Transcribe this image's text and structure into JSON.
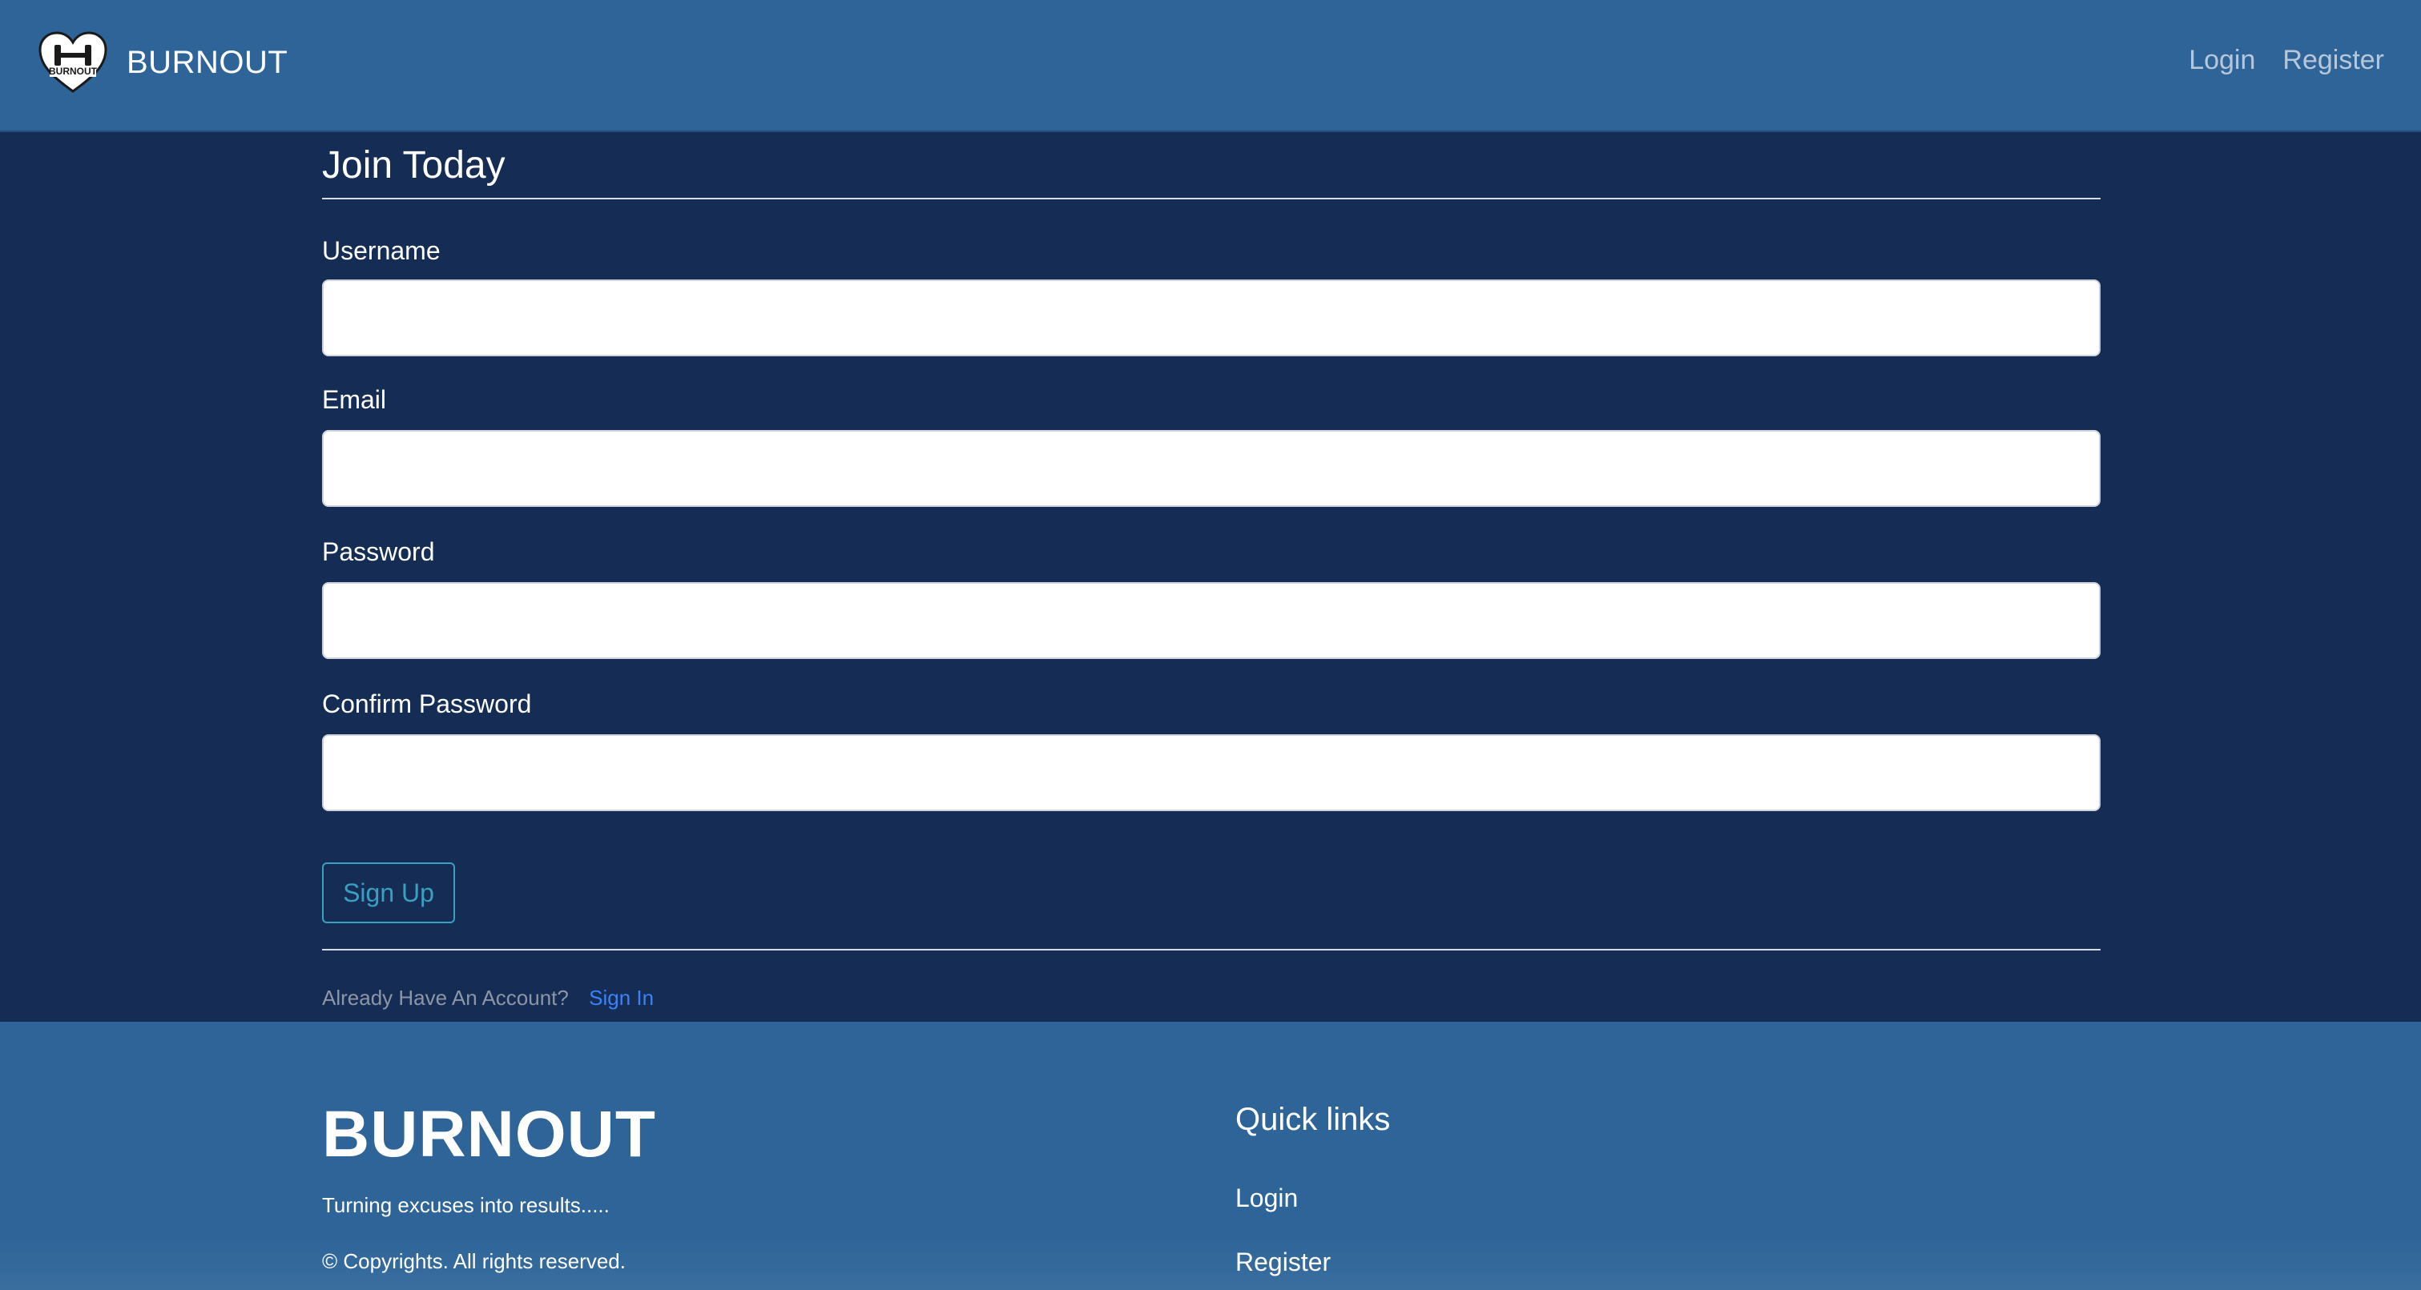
{
  "navbar": {
    "brand_name": "BURNOUT",
    "logo_text": "BURNOUT",
    "links": {
      "login": "Login",
      "register": "Register"
    }
  },
  "form": {
    "legend": "Join Today",
    "fields": {
      "username": {
        "label": "Username",
        "value": ""
      },
      "email": {
        "label": "Email",
        "value": ""
      },
      "password": {
        "label": "Password",
        "value": ""
      },
      "confirm_password": {
        "label": "Confirm Password",
        "value": ""
      }
    },
    "submit_label": "Sign Up",
    "signin_prompt": "Already Have An Account?",
    "signin_link": "Sign In"
  },
  "footer": {
    "brand": "BURNOUT",
    "tagline": "Turning excuses into results.....",
    "copyright": "© Copyrights. All rights reserved.",
    "quick_links_heading": "Quick links",
    "quick_links": {
      "login": "Login",
      "register": "Register"
    }
  },
  "colors": {
    "navbar_bg": "#2e6498",
    "page_bg": "#152c54",
    "footer_bg": "#2e6498",
    "button_accent": "#3aa0c2",
    "link_accent": "#3b82f6",
    "muted_text": "#8d96a6"
  }
}
